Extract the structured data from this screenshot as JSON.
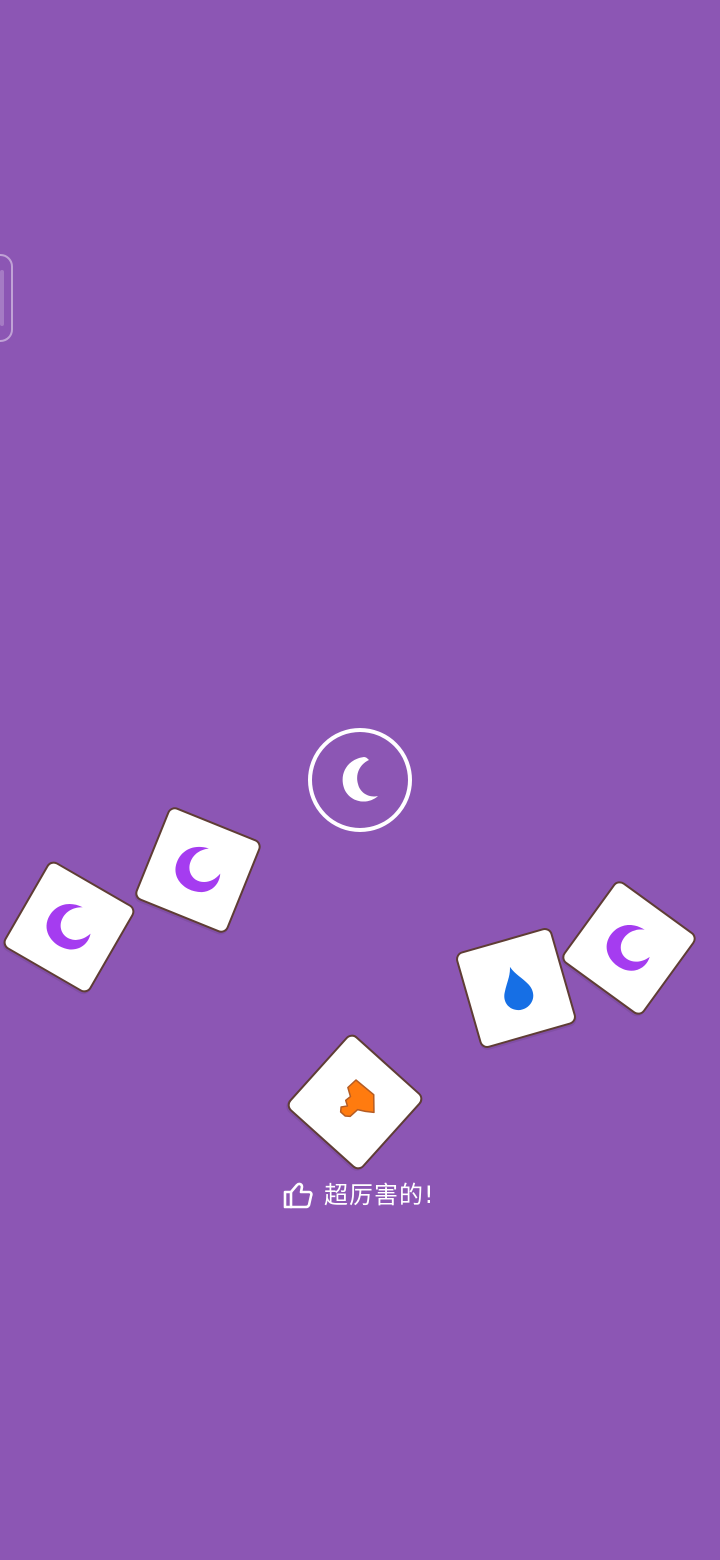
{
  "game": {
    "praise_text": "超厉害的!",
    "colors": {
      "background": "#8c56b4",
      "moon_tile": "#a53cf0",
      "drop_tile": "#166fe5",
      "shard_tile": "#ff7b0f",
      "tile_border": "#5f3d35",
      "target_icon": "#ffffff"
    },
    "target_symbol": "moon-icon",
    "tiles": [
      {
        "symbol": "moon-icon",
        "color": "purple"
      },
      {
        "symbol": "moon-icon",
        "color": "purple"
      },
      {
        "symbol": "shard-icon",
        "color": "orange"
      },
      {
        "symbol": "drop-icon",
        "color": "blue"
      },
      {
        "symbol": "moon-icon",
        "color": "purple"
      }
    ]
  }
}
